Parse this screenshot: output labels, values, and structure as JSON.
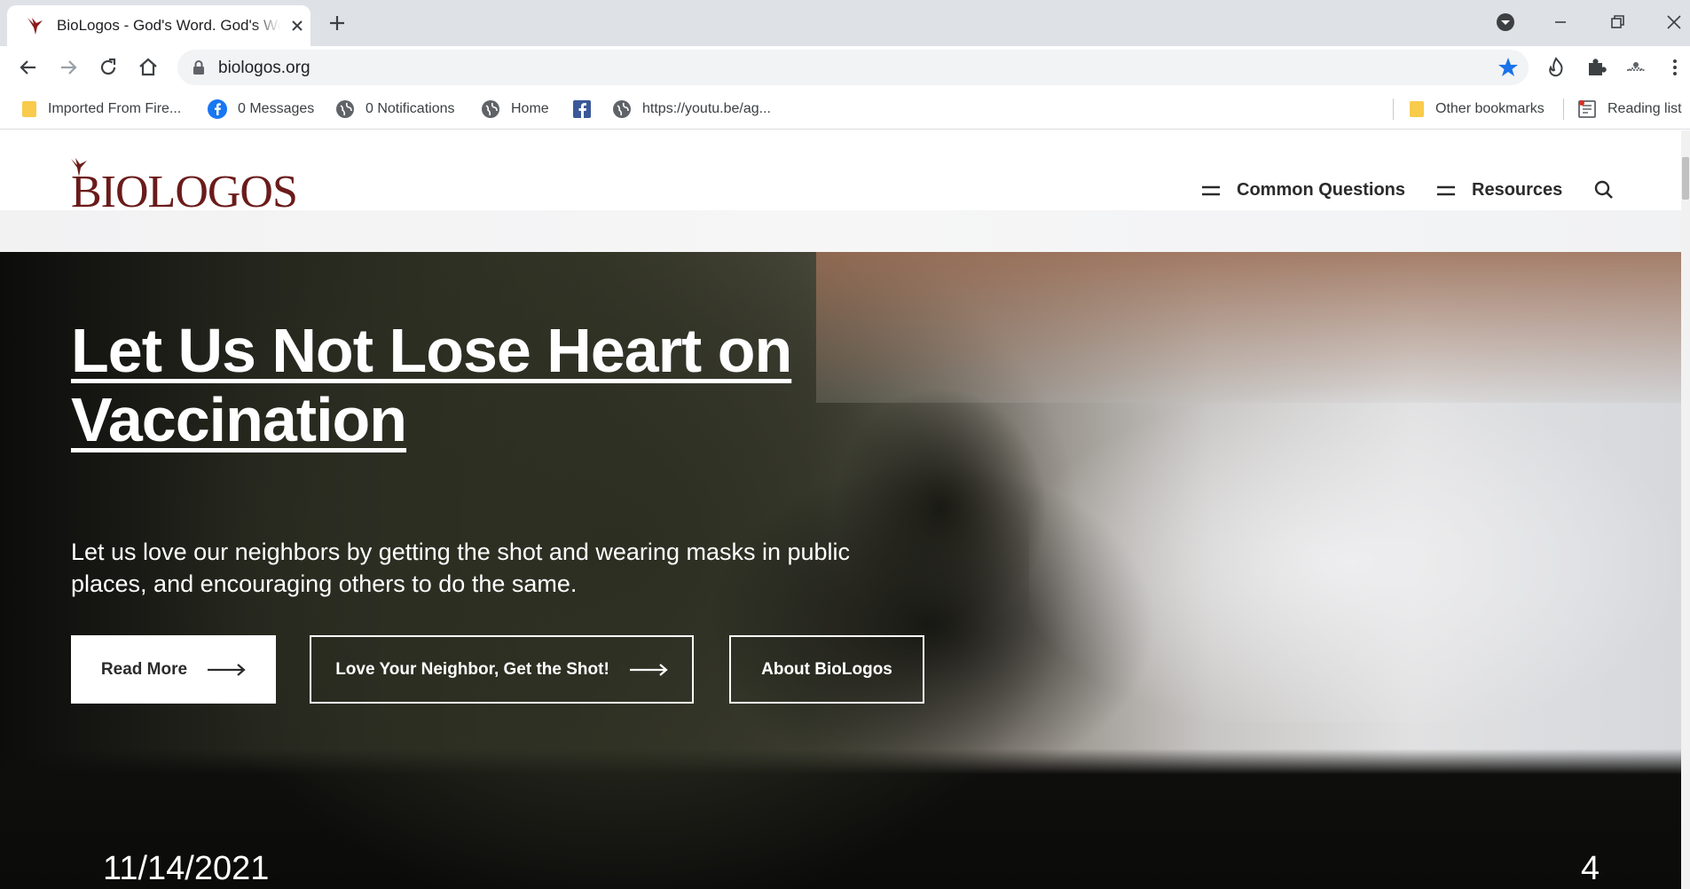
{
  "browser": {
    "tab_title": "BioLogos - God's Word. God's World",
    "url": "biologos.org",
    "bookmarks": [
      {
        "label": "Imported From Fire...",
        "icon": "folder-icon"
      },
      {
        "label": "0 Messages",
        "icon": "facebook-icon"
      },
      {
        "label": "0 Notifications",
        "icon": "globe-icon"
      },
      {
        "label": "Home",
        "icon": "globe-icon"
      },
      {
        "label": "",
        "icon": "facebook-icon"
      },
      {
        "label": "https://youtu.be/ag...",
        "icon": "globe-icon"
      }
    ],
    "other_bookmarks": "Other bookmarks",
    "reading_list": "Reading list",
    "accent_color": "#1a73e8"
  },
  "site": {
    "logo_text": "BIOLOGOS",
    "brand_color": "#6b1b1b",
    "nav": [
      {
        "label": "Common Questions"
      },
      {
        "label": "Resources"
      }
    ]
  },
  "hero": {
    "title": "Let Us Not Lose Heart on Vaccination",
    "subtitle": "Let us love our neighbors by getting the shot and wearing masks in public places, and encouraging others to do the same.",
    "buttons": [
      {
        "label": "Read More"
      },
      {
        "label": "Love Your Neighbor, Get the Shot!"
      },
      {
        "label": "About BioLogos"
      }
    ]
  },
  "slide": {
    "date": "11/14/2021",
    "number": "4"
  }
}
